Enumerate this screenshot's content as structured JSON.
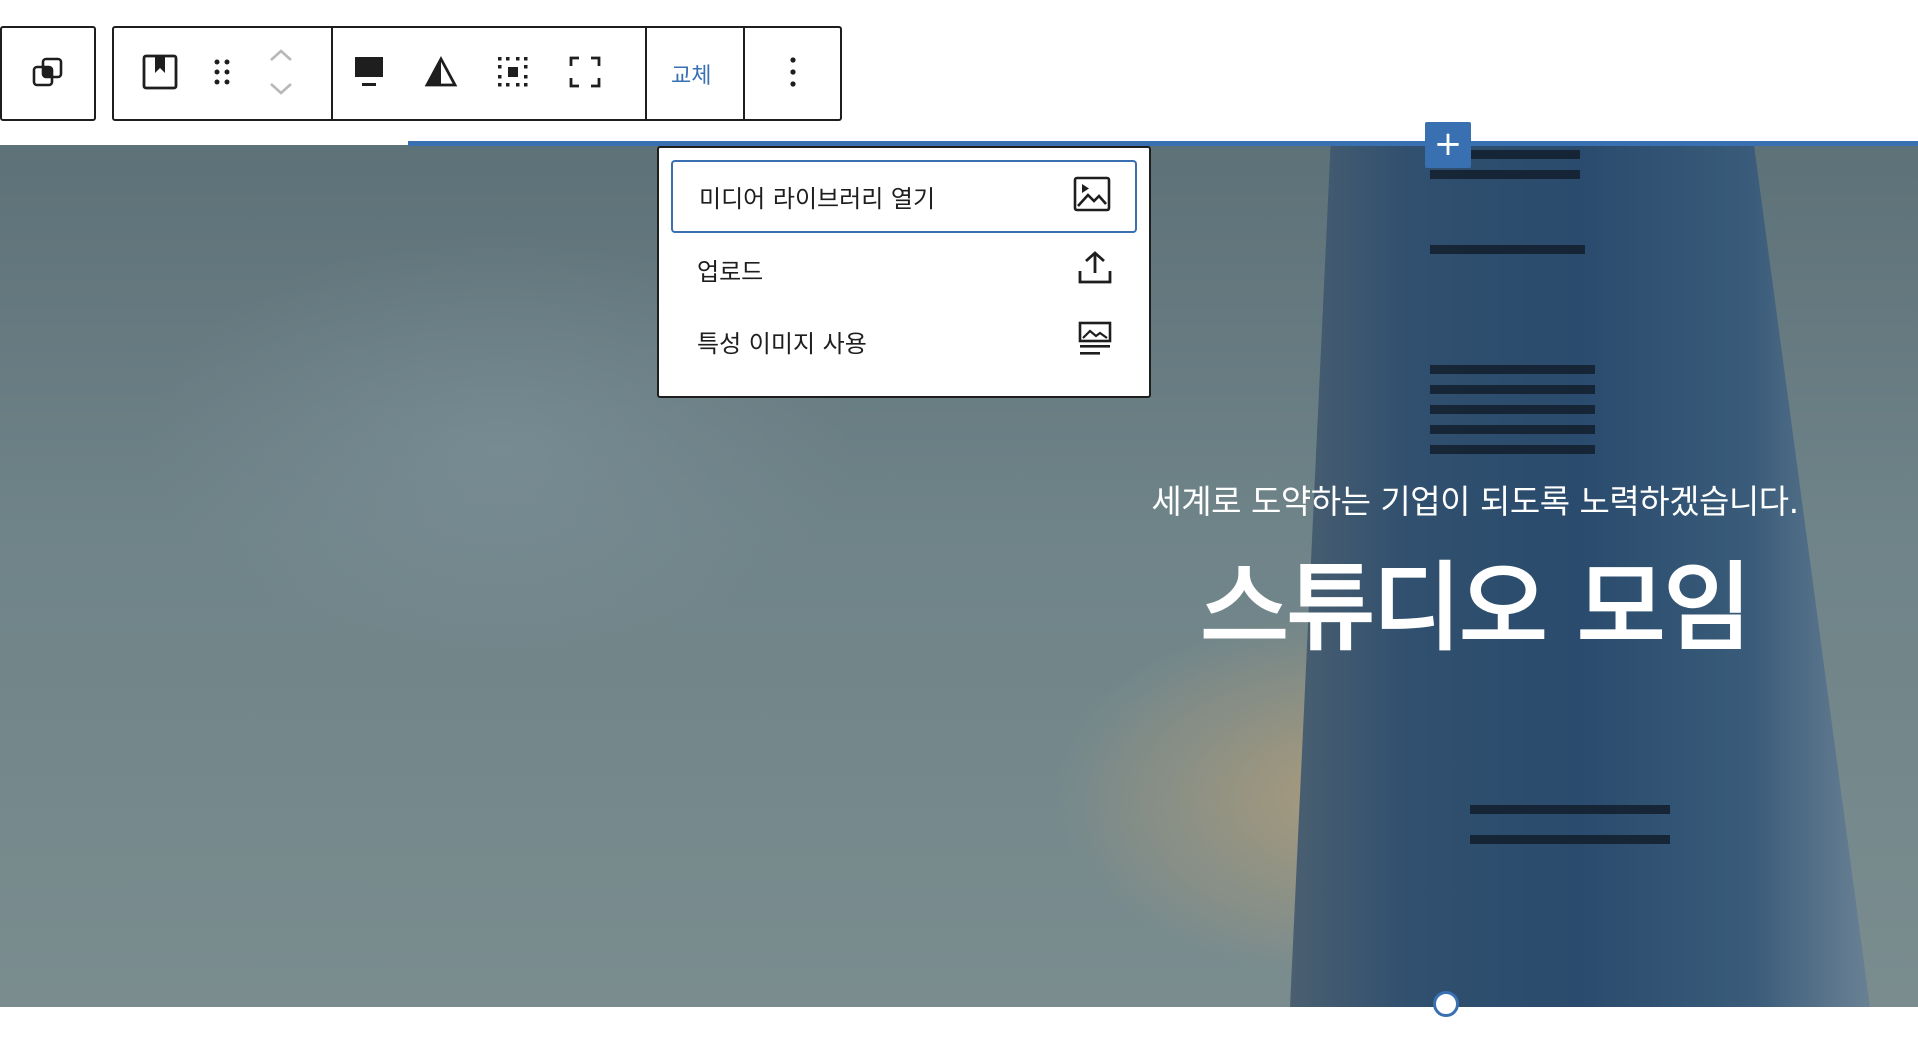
{
  "toolbar": {
    "replace_label": "교체",
    "icons": [
      "transform-icon",
      "block-icon",
      "drag-handle-icon",
      "chevron-up-icon",
      "chevron-down-icon",
      "align-icon",
      "contrast-icon",
      "position-grid-icon",
      "fullscreen-icon",
      "more-options-icon"
    ]
  },
  "media_menu": {
    "items": [
      {
        "label": "미디어 라이브러리 열기",
        "icon": "image-icon"
      },
      {
        "label": "업로드",
        "icon": "upload-icon"
      },
      {
        "label": "특성 이미지 사용",
        "icon": "featured-image-icon"
      }
    ]
  },
  "hero": {
    "subtitle": "세계로 도약하는 기업이 되도록 노력하겠습니다.",
    "title": "스튜디오 모임"
  },
  "colors": {
    "accent": "#3870b1",
    "border": "#1e1e1e"
  }
}
